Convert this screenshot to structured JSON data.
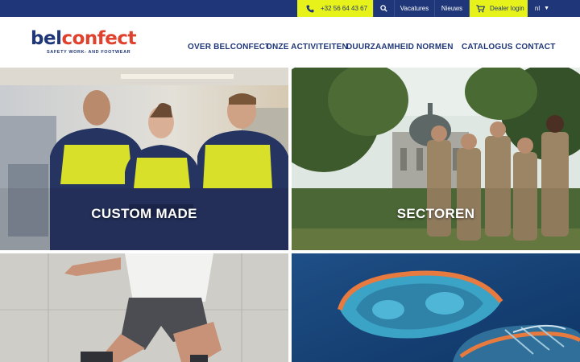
{
  "topbar": {
    "phone": "+32 56 64 43 67",
    "vacatures": "Vacatures",
    "nieuws": "Nieuws",
    "dealer_login": "Dealer login",
    "language": "nl"
  },
  "brand": {
    "logo_part1": "bel",
    "logo_part2": "confect",
    "tagline": "SAFETY WORK- AND FOOTWEAR"
  },
  "nav": {
    "items": [
      "OVER BELCONFECT",
      "ONZE ACTIVITEITEN",
      "DUURZAAMHEID",
      "NORMEN",
      "CATALOGUS",
      "CONTACT"
    ]
  },
  "tiles": [
    {
      "label": "CUSTOM MADE"
    },
    {
      "label": "SECTOREN"
    },
    {
      "label": ""
    },
    {
      "label": ""
    }
  ],
  "colors": {
    "navy": "#1f3778",
    "yellow": "#e6f21a",
    "logo_red": "#e0412d"
  }
}
